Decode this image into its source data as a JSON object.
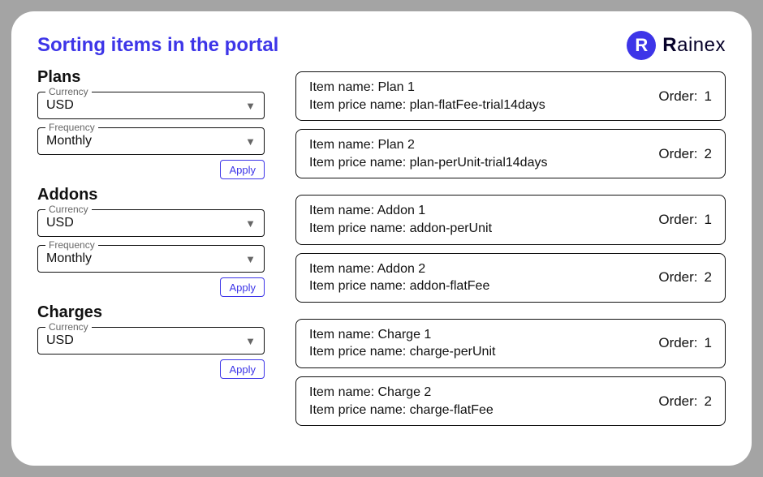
{
  "header": {
    "title": "Sorting items in the portal",
    "brand_letter": "R",
    "brand_name_bold": "R",
    "brand_name_rest": "ainex"
  },
  "labels": {
    "currency": "Currency",
    "frequency": "Frequency",
    "apply": "Apply",
    "item_name_prefix": "Item name:",
    "item_price_prefix": "Item price name:",
    "order_prefix": "Order:"
  },
  "sections": [
    {
      "title": "Plans",
      "currency": "USD",
      "frequency": "Monthly",
      "has_frequency": true
    },
    {
      "title": "Addons",
      "currency": "USD",
      "frequency": "Monthly",
      "has_frequency": true
    },
    {
      "title": "Charges",
      "currency": "USD",
      "has_frequency": false
    }
  ],
  "item_groups": [
    [
      {
        "name": "Plan 1",
        "price_name": "plan-flatFee-trial14days",
        "order": "1"
      },
      {
        "name": "Plan 2",
        "price_name": "plan-perUnit-trial14days",
        "order": "2"
      }
    ],
    [
      {
        "name": "Addon 1",
        "price_name": "addon-perUnit",
        "order": "1"
      },
      {
        "name": "Addon 2",
        "price_name": "addon-flatFee",
        "order": "2"
      }
    ],
    [
      {
        "name": "Charge 1",
        "price_name": "charge-perUnit",
        "order": "1"
      },
      {
        "name": "Charge 2",
        "price_name": "charge-flatFee",
        "order": "2"
      }
    ]
  ]
}
